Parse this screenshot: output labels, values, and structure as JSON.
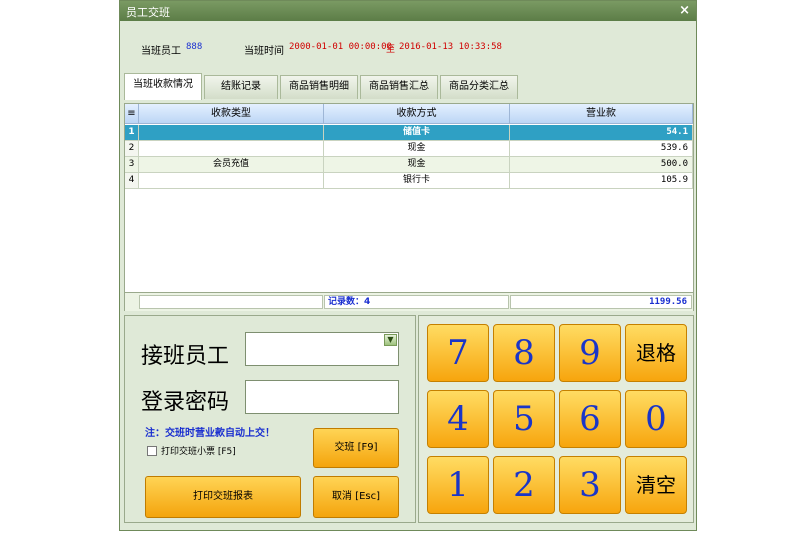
{
  "window": {
    "title": "员工交班",
    "close": "×"
  },
  "info": {
    "employee_label": "当班员工",
    "employee_value": "888",
    "time_label": "当班时间",
    "time_start": "2000-01-01 00:00:00",
    "time_sep": "至",
    "time_end": "2016-01-13 10:33:58"
  },
  "tabs": [
    {
      "label": "当班收款情况"
    },
    {
      "label": "结账记录"
    },
    {
      "label": "商品销售明细"
    },
    {
      "label": "商品销售汇总"
    },
    {
      "label": "商品分类汇总"
    }
  ],
  "grid": {
    "corner": "≡",
    "columns": [
      "收款类型",
      "收款方式",
      "营业款"
    ],
    "rows": [
      {
        "num": "1",
        "type": "",
        "method": "储值卡",
        "amount": "54.1"
      },
      {
        "num": "2",
        "type": "",
        "method": "现金",
        "amount": "539.6"
      },
      {
        "num": "3",
        "type": "会员充值",
        "method": "现金",
        "amount": "500.0"
      },
      {
        "num": "4",
        "type": "",
        "method": "银行卡",
        "amount": "105.9"
      }
    ],
    "footer_count": "记录数：4",
    "footer_total": "1199.56"
  },
  "form": {
    "next_employee_label": "接班员工",
    "password_label": "登录密码",
    "note": "注：交班时营业款自动上交！",
    "print_ticket_label": "打印交班小票 [F5]",
    "handover_button": "交班 [F9]",
    "print_report_button": "打印交班报表",
    "cancel_button": "取消 [Esc]"
  },
  "keypad": {
    "keys": [
      "7",
      "8",
      "9",
      "退格",
      "4",
      "5",
      "6",
      "0",
      "1",
      "2",
      "3",
      "清空"
    ]
  },
  "colors": {
    "accent": "#f7a50d",
    "selected_row": "#2fa0c4",
    "digit": "#1a35c8",
    "frame": "#dfe9d7"
  }
}
